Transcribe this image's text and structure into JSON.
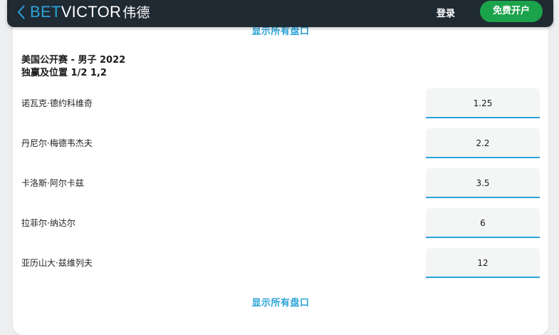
{
  "header": {
    "logo_bet": "BET",
    "logo_victor": "VICTOR",
    "logo_cn": "伟德",
    "login_label": "登录",
    "signup_label": "免费开户"
  },
  "market": {
    "top_link_label": "显示所有盘口",
    "event_title": "美国公开赛 - 男子 2022",
    "market_name": "独赢及位置 1/2 1,2",
    "selections": [
      {
        "name": "诺瓦克·德约科维奇",
        "odds": "1.25"
      },
      {
        "name": "丹尼尔·梅德韦杰夫",
        "odds": "2.2"
      },
      {
        "name": "卡洛斯·阿尔卡兹",
        "odds": "3.5"
      },
      {
        "name": "拉菲尔·纳达尔",
        "odds": "6"
      },
      {
        "name": "亚历山大·兹维列夫",
        "odds": "12"
      }
    ],
    "bottom_link_label": "显示所有盘口"
  },
  "colors": {
    "header_bg": "#1f2a33",
    "accent_blue": "#2ba3d8",
    "signup_green": "#1aa34a"
  },
  "icons": {
    "back": "chevron-left-icon"
  }
}
